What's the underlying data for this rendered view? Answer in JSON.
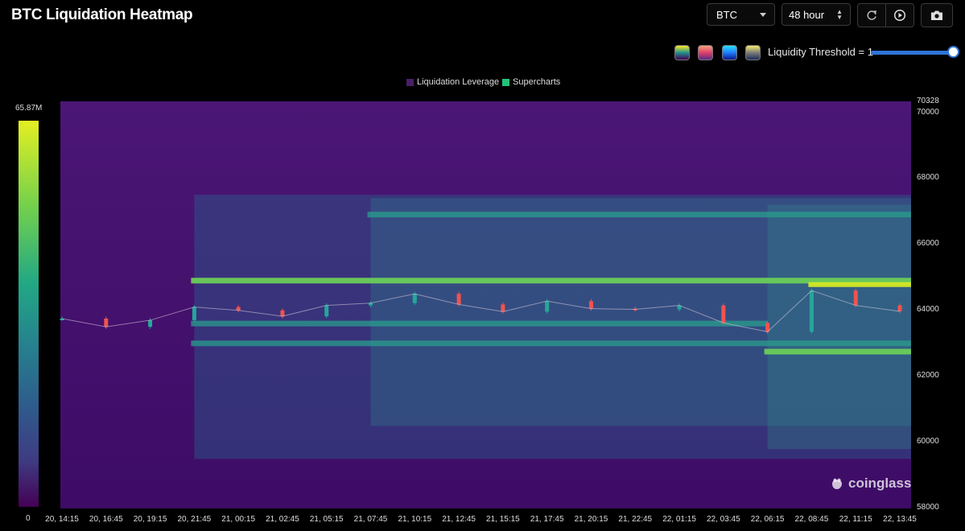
{
  "header": {
    "title": "BTC Liquidation Heatmap"
  },
  "controls": {
    "coin_select": "BTC",
    "range_select": "48 hour",
    "refresh_icon": "refresh-icon",
    "play_icon": "play-icon",
    "camera_icon": "camera-icon",
    "color_themes": [
      {
        "name": "viridis",
        "gradient": [
          "#440154",
          "#21918c",
          "#fde725"
        ]
      },
      {
        "name": "sunset",
        "gradient": [
          "#5b2a86",
          "#e0406a",
          "#f3a07a"
        ]
      },
      {
        "name": "ocean",
        "gradient": [
          "#0b1a8c",
          "#1f7cff",
          "#27e0ff"
        ]
      },
      {
        "name": "cividis",
        "gradient": [
          "#1f2f5a",
          "#7c7b78",
          "#f3e96b"
        ]
      }
    ],
    "threshold_label": "Liquidity Threshold = 1",
    "threshold_value": 1
  },
  "colors": {
    "low": "#440154",
    "high": "#e4ef22",
    "candle_up": "#26a69a",
    "candle_down": "#ef5350"
  },
  "watermark": "coinglass",
  "chart_data": {
    "type": "heatmap",
    "title": "BTC Liquidation Heatmap",
    "legend": [
      {
        "name": "Liquidation Leverage",
        "color": "#4a1f66"
      },
      {
        "name": "Supercharts",
        "color": "#22c27a"
      }
    ],
    "legend_position": "top-center",
    "colorbar": {
      "min_label": "0",
      "max_label": "65.87M",
      "min": 0,
      "max": 65870000
    },
    "y_axis": {
      "min": 58000,
      "max": 70328,
      "ticks": [
        70328,
        70000,
        68000,
        66000,
        64000,
        62000,
        60000,
        58000
      ]
    },
    "x_ticks": [
      "20, 14:15",
      "20, 16:45",
      "20, 19:15",
      "20, 21:45",
      "21, 00:15",
      "21, 02:45",
      "21, 05:15",
      "21, 07:45",
      "21, 10:15",
      "21, 12:45",
      "21, 15:15",
      "21, 17:45",
      "21, 20:15",
      "21, 22:45",
      "22, 01:15",
      "22, 03:45",
      "22, 06:15",
      "22, 08:45",
      "22, 11:15",
      "22, 13:45"
    ],
    "liquidation_bands": [
      {
        "price": 64900,
        "from": "20, 21:45",
        "to": "22, 13:45",
        "intensity": "high"
      },
      {
        "price": 64780,
        "from": "22, 08:45",
        "to": "22, 13:45",
        "intensity": "max"
      },
      {
        "price": 63600,
        "from": "20, 21:45",
        "to": "22, 06:15",
        "intensity": "medium"
      },
      {
        "price": 63000,
        "from": "20, 21:45",
        "to": "22, 13:45",
        "intensity": "medium"
      },
      {
        "price": 62750,
        "from": "22, 06:15",
        "to": "22, 13:45",
        "intensity": "high"
      },
      {
        "price": 66900,
        "from": "21, 07:45",
        "to": "22, 13:45",
        "intensity": "medium"
      }
    ],
    "price_series": [
      {
        "t": "20, 14:15",
        "price": 63750
      },
      {
        "t": "20, 16:45",
        "price": 63500
      },
      {
        "t": "20, 19:15",
        "price": 63700
      },
      {
        "t": "20, 21:45",
        "price": 64100
      },
      {
        "t": "21, 00:15",
        "price": 64000
      },
      {
        "t": "21, 02:45",
        "price": 63820
      },
      {
        "t": "21, 05:15",
        "price": 64150
      },
      {
        "t": "21, 07:45",
        "price": 64220
      },
      {
        "t": "21, 10:15",
        "price": 64500
      },
      {
        "t": "21, 12:45",
        "price": 64180
      },
      {
        "t": "21, 15:15",
        "price": 63960
      },
      {
        "t": "21, 17:45",
        "price": 64280
      },
      {
        "t": "21, 20:15",
        "price": 64050
      },
      {
        "t": "21, 22:45",
        "price": 64030
      },
      {
        "t": "22, 01:15",
        "price": 64150
      },
      {
        "t": "22, 03:45",
        "price": 63620
      },
      {
        "t": "22, 06:15",
        "price": 63350
      },
      {
        "t": "22, 08:45",
        "price": 64600
      },
      {
        "t": "22, 11:15",
        "price": 64150
      },
      {
        "t": "22, 13:45",
        "price": 63970
      }
    ]
  }
}
